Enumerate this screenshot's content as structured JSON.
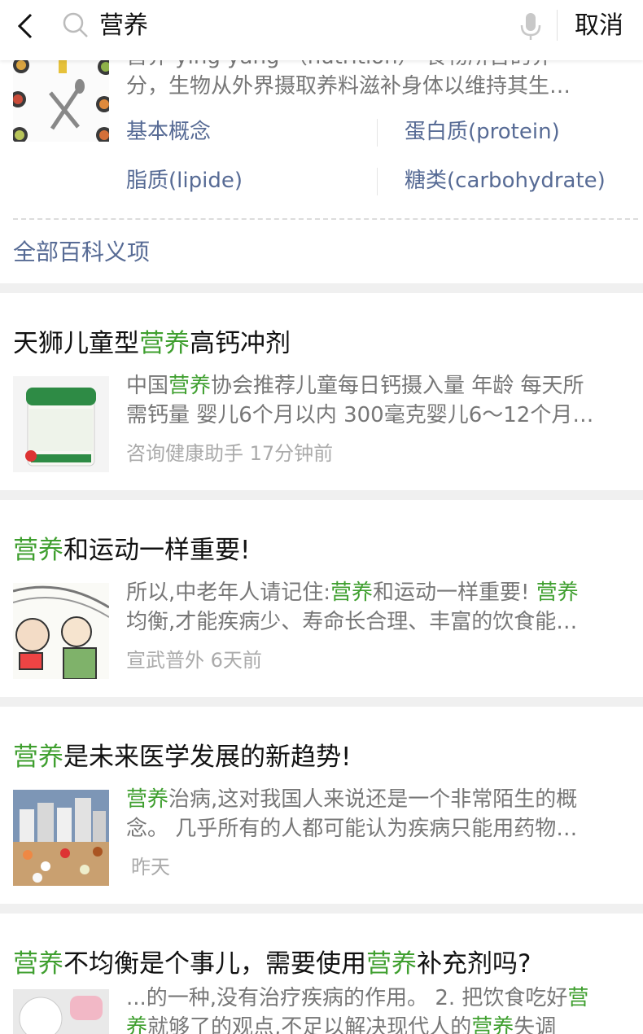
{
  "search": {
    "query": "营养",
    "cancel_label": "取消"
  },
  "baike": {
    "text_line1": "营养 yíng yǎng （nutrition） 食物所含的养",
    "text_line2": "分，生物从外界摄取养料滋补身体以维持其生…",
    "links": [
      "基本概念",
      "蛋白质(protein)",
      "脂质(lipide)",
      "糖类(carbohydrate)"
    ],
    "all_label": "全部百科义项"
  },
  "results": [
    {
      "title": [
        "天狮儿童型",
        "营养",
        "高钙冲剂"
      ],
      "line1": [
        "中国",
        "营养",
        "协会推荐儿童每日钙摄入量 年龄 每天所"
      ],
      "line2": [
        "需钙量 婴儿6个月以内 300毫克婴儿6～12个月…"
      ],
      "meta": "咨询健康助手 17分钟前"
    },
    {
      "title": [
        "",
        "营养",
        "和运动一样重要!"
      ],
      "line1": [
        "所以,中老年人请记住:",
        "营养",
        "和运动一样重要! ",
        "营养"
      ],
      "line2": [
        "均衡,才能疾病少、寿命长合理、丰富的饮食能…"
      ],
      "meta": "宣武普外 6天前"
    },
    {
      "title": [
        "",
        "营养",
        "是未来医学发展的新趋势!"
      ],
      "line1": [
        "",
        "营养",
        "治病,这对我国人来说还是一个非常陌生的概"
      ],
      "line2": [
        "念。 几乎所有的人都可能认为疾病只能用药物…"
      ],
      "meta": "昨天"
    },
    {
      "title": [
        "",
        "营养",
        "不均衡是个事儿，需要使用",
        "营养",
        "补充剂吗?"
      ],
      "line1": [
        "...的一种,没有治疗疾病的作用。 2. 把饮食吃好",
        "营"
      ],
      "line2": [
        "养",
        "就够了的观点,不足以解决现代人的",
        "营养",
        "失调"
      ],
      "meta": ""
    }
  ],
  "colors": {
    "highlight": "#3f9f2f",
    "link": "#576b95",
    "divider": "#f0f0f0"
  }
}
